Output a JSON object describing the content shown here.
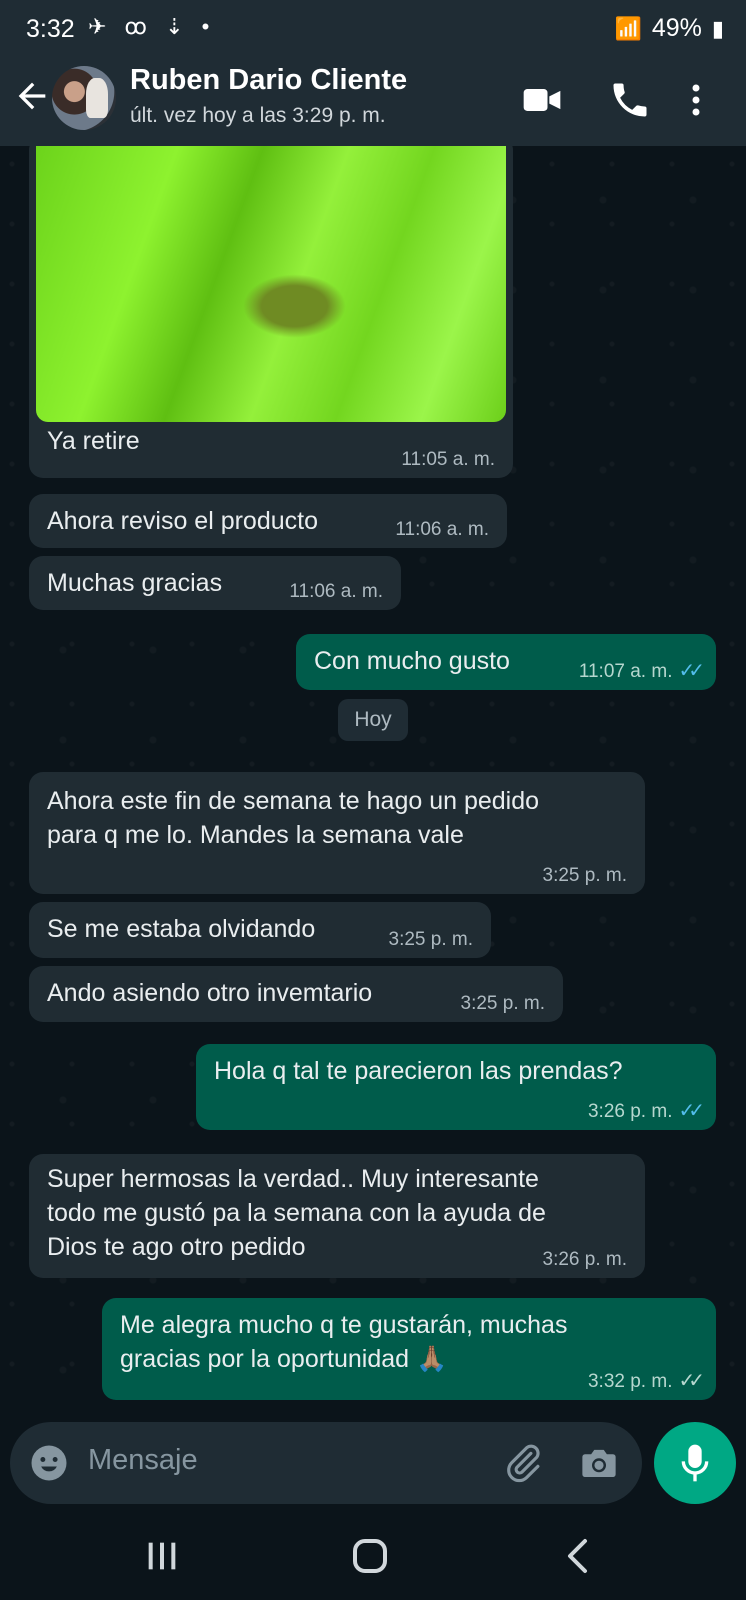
{
  "status_bar": {
    "time": "3:32",
    "battery": "49%"
  },
  "header": {
    "contact_name": "Ruben Dario Cliente",
    "last_seen": "últ. vez hoy a las 3:29 p. m."
  },
  "messages": [
    {
      "dir": "in",
      "text": "Ya retire",
      "time": "11:05 a. m."
    },
    {
      "dir": "in",
      "text": "Ahora reviso el producto",
      "time": "11:06 a. m."
    },
    {
      "dir": "in",
      "text": "Muchas gracias",
      "time": "11:06 a. m."
    },
    {
      "dir": "out",
      "text": "Con mucho gusto",
      "time": "11:07 a. m.",
      "ticks": "read"
    },
    {
      "dir": "in",
      "text": "Ahora este fin de semana te hago un pedido\npara q me lo. Mandes la semana vale",
      "time": "3:25 p. m."
    },
    {
      "dir": "in",
      "text": "Se me estaba olvidando",
      "time": "3:25 p. m."
    },
    {
      "dir": "in",
      "text": "Ando asiendo otro invemtario",
      "time": "3:25 p. m."
    },
    {
      "dir": "out",
      "text": "Hola  q tal te parecieron  las prendas?",
      "time": "3:26 p. m.",
      "ticks": "read"
    },
    {
      "dir": "in",
      "text": "Super hermosas la verdad.. Muy interesante\ntodo me gustó pa la semana con la ayuda de\nDios te ago otro pedido",
      "time": "3:26 p. m."
    },
    {
      "dir": "out",
      "text": "Me alegra mucho q te gustarán, muchas\ngracias por la oportunidad 🙏🏽",
      "time": "3:32 p. m.",
      "ticks": "delivered"
    }
  ],
  "date_divider": "Hoy",
  "composer": {
    "placeholder": "Mensaje"
  },
  "colors": {
    "incoming": "#202c33",
    "outgoing": "#005c4b",
    "accent": "#00a884",
    "read_ticks": "#53bdeb"
  }
}
